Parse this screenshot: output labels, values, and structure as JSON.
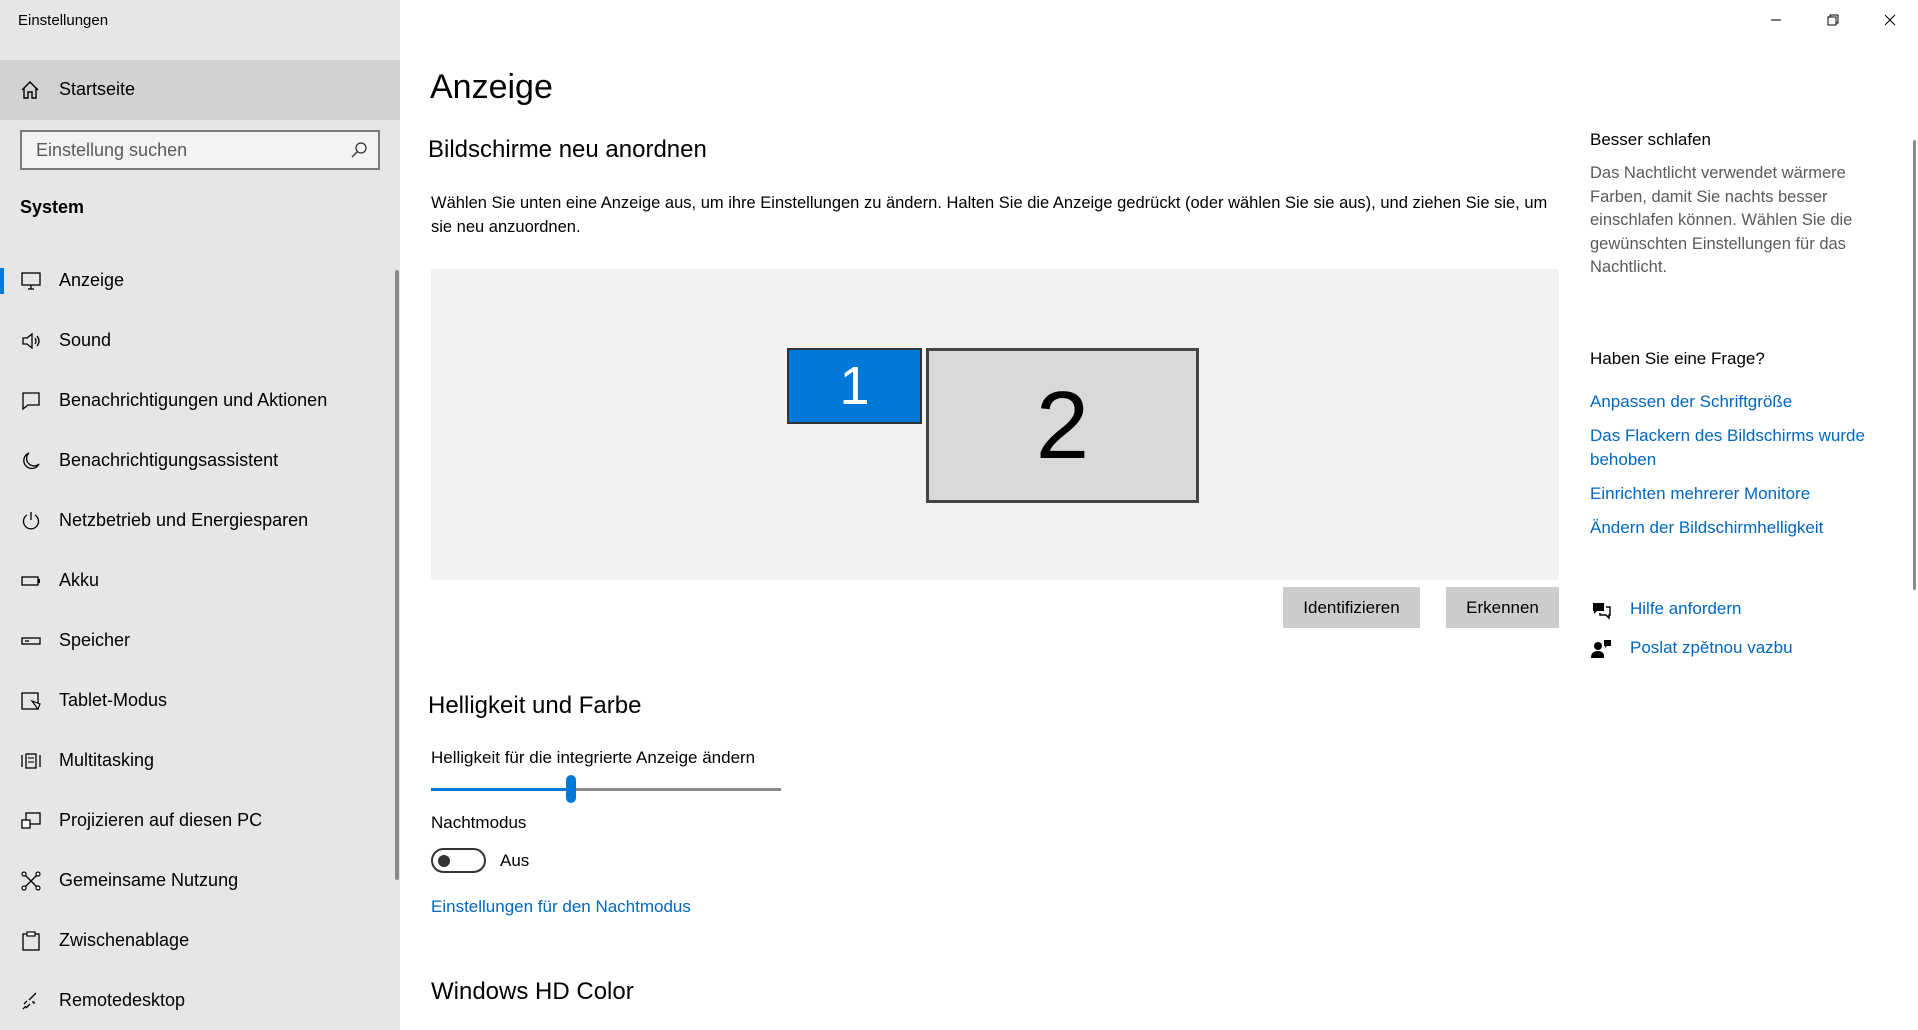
{
  "window": {
    "title": "Einstellungen",
    "controls": [
      "minimize-icon",
      "restore-icon",
      "close-icon"
    ]
  },
  "sidebar": {
    "home_label": "Startseite",
    "search_placeholder": "Einstellung suchen",
    "section": "System",
    "items": [
      {
        "label": "Anzeige",
        "icon": "monitor-icon",
        "active": true
      },
      {
        "label": "Sound",
        "icon": "speaker-icon"
      },
      {
        "label": "Benachrichtigungen und Aktionen",
        "icon": "notification-icon"
      },
      {
        "label": "Benachrichtigungsassistent",
        "icon": "moon-icon"
      },
      {
        "label": "Netzbetrieb und Energiesparen",
        "icon": "power-icon"
      },
      {
        "label": "Akku",
        "icon": "battery-icon"
      },
      {
        "label": "Speicher",
        "icon": "storage-icon"
      },
      {
        "label": "Tablet-Modus",
        "icon": "tablet-icon"
      },
      {
        "label": "Multitasking",
        "icon": "multitasking-icon"
      },
      {
        "label": "Projizieren auf diesen PC",
        "icon": "project-icon"
      },
      {
        "label": "Gemeinsame Nutzung",
        "icon": "share-icon"
      },
      {
        "label": "Zwischenablage",
        "icon": "clipboard-icon"
      },
      {
        "label": "Remotedesktop",
        "icon": "remote-icon"
      }
    ]
  },
  "main": {
    "title": "Anzeige",
    "rearrange_heading": "Bildschirme neu anordnen",
    "rearrange_desc": "Wählen Sie unten eine Anzeige aus, um ihre Einstellungen zu ändern. Halten Sie die Anzeige gedrückt (oder wählen Sie sie aus), und ziehen Sie sie, um sie neu anzuordnen.",
    "monitor1": "1",
    "monitor2": "2",
    "identify_button": "Identifizieren",
    "detect_button": "Erkennen",
    "brightness_heading": "Helligkeit und Farbe",
    "brightness_label": "Helligkeit für die integrierte Anzeige ändern",
    "brightness_value": 0.4,
    "night_label": "Nachtmodus",
    "night_state": "Aus",
    "night_link": "Einstellungen für den Nachtmodus",
    "hdr_heading": "Windows HD Color"
  },
  "right": {
    "sleep_heading": "Besser schlafen",
    "sleep_text": "Das Nachtlicht verwendet wärmere Farben, damit Sie nachts besser einschlafen können. Wählen Sie die gewünschten Einstellungen für das Nachtlicht.",
    "question_heading": "Haben Sie eine Frage?",
    "links": [
      "Anpassen der Schriftgröße",
      "Das Flackern des Bildschirms wurde behoben",
      "Einrichten mehrerer Monitore",
      "Ändern der Bildschirmhelligkeit"
    ],
    "help_label": "Hilfe anfordern",
    "feedback_label": "Poslat zpětnou vazbu"
  },
  "colors": {
    "accent": "#0078d7",
    "link": "#0067c0",
    "sidebar_bg": "#e6e6e6"
  }
}
